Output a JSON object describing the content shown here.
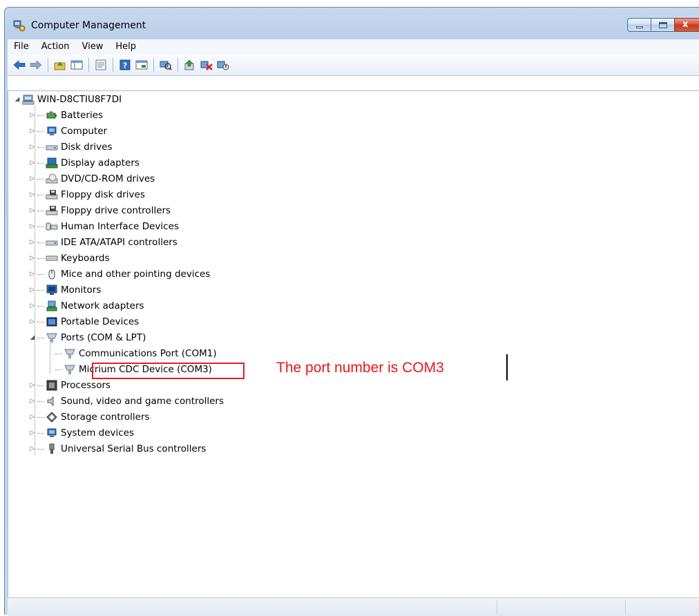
{
  "window": {
    "title": "Computer Management",
    "icon": "computer-management-icon",
    "controls": [
      "minimize",
      "maximize",
      "close"
    ]
  },
  "menubar": {
    "items": [
      "File",
      "Action",
      "View",
      "Help"
    ]
  },
  "toolbar": {
    "buttons": [
      "back-arrow-icon",
      "forward-arrow-icon",
      "up-folder-icon",
      "show-hide-tree-icon",
      "properties-icon",
      "help-icon",
      "console-icon",
      "scan-hardware-icon",
      "update-driver-icon",
      "uninstall-icon",
      "disable-device-icon"
    ]
  },
  "tree": {
    "root": "WIN-D8CTIU8F7DI",
    "categories": [
      {
        "label": "Batteries",
        "icon": "battery-icon"
      },
      {
        "label": "Computer",
        "icon": "computer-icon"
      },
      {
        "label": "Disk drives",
        "icon": "disk-drive-icon"
      },
      {
        "label": "Display adapters",
        "icon": "display-adapter-icon"
      },
      {
        "label": "DVD/CD-ROM drives",
        "icon": "dvd-drive-icon"
      },
      {
        "label": "Floppy disk drives",
        "icon": "floppy-disk-icon"
      },
      {
        "label": "Floppy drive controllers",
        "icon": "floppy-controller-icon"
      },
      {
        "label": "Human Interface Devices",
        "icon": "hid-icon"
      },
      {
        "label": "IDE ATA/ATAPI controllers",
        "icon": "ide-controller-icon"
      },
      {
        "label": "Keyboards",
        "icon": "keyboard-icon"
      },
      {
        "label": "Mice and other pointing devices",
        "icon": "mouse-icon"
      },
      {
        "label": "Monitors",
        "icon": "monitor-icon"
      },
      {
        "label": "Network adapters",
        "icon": "network-adapter-icon"
      },
      {
        "label": "Portable Devices",
        "icon": "portable-device-icon"
      },
      {
        "label": "Ports (COM & LPT)",
        "icon": "port-icon",
        "expanded": true,
        "children": [
          {
            "label": "Communications Port (COM1)",
            "icon": "port-icon"
          },
          {
            "label": "Micrium CDC Device (COM3)",
            "icon": "port-icon",
            "highlighted": true
          }
        ]
      },
      {
        "label": "Processors",
        "icon": "processor-icon"
      },
      {
        "label": "Sound, video and game controllers",
        "icon": "sound-icon"
      },
      {
        "label": "Storage controllers",
        "icon": "storage-controller-icon"
      },
      {
        "label": "System devices",
        "icon": "system-device-icon"
      },
      {
        "label": "Universal Serial Bus controllers",
        "icon": "usb-icon"
      }
    ]
  },
  "annotation": {
    "text": "The port number is COM3",
    "color": "#e8161b"
  },
  "colors": {
    "highlight_border": "#e02020",
    "window_frame": "#c7d9ee"
  }
}
